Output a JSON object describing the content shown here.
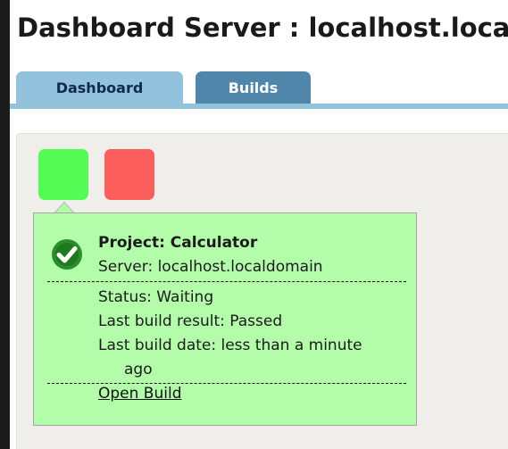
{
  "header": {
    "title": "Dashboard Server : localhost.localdomain"
  },
  "tabs": [
    {
      "label": "Dashboard",
      "active": true
    },
    {
      "label": "Builds",
      "active": false
    }
  ],
  "projects": [
    {
      "status_color": "#55fc55",
      "state": "passed"
    },
    {
      "status_color": "#fc5d5d",
      "state": "failed"
    }
  ],
  "popup": {
    "icon": "check-circle-icon",
    "project_label": "Project: Calculator",
    "server_label": "Server: localhost.localdomain",
    "status_label": "Status: Waiting",
    "result_label": "Last build result: Passed",
    "date_label": "Last build date: less than a minute",
    "date_label_cont": "ago",
    "open_build_label": "Open Build"
  },
  "colors": {
    "tab_active": "#93c2dc",
    "tab_inactive": "#5086aa",
    "popup_bg": "#b3fcaa",
    "panel_bg": "#efeeeb"
  }
}
